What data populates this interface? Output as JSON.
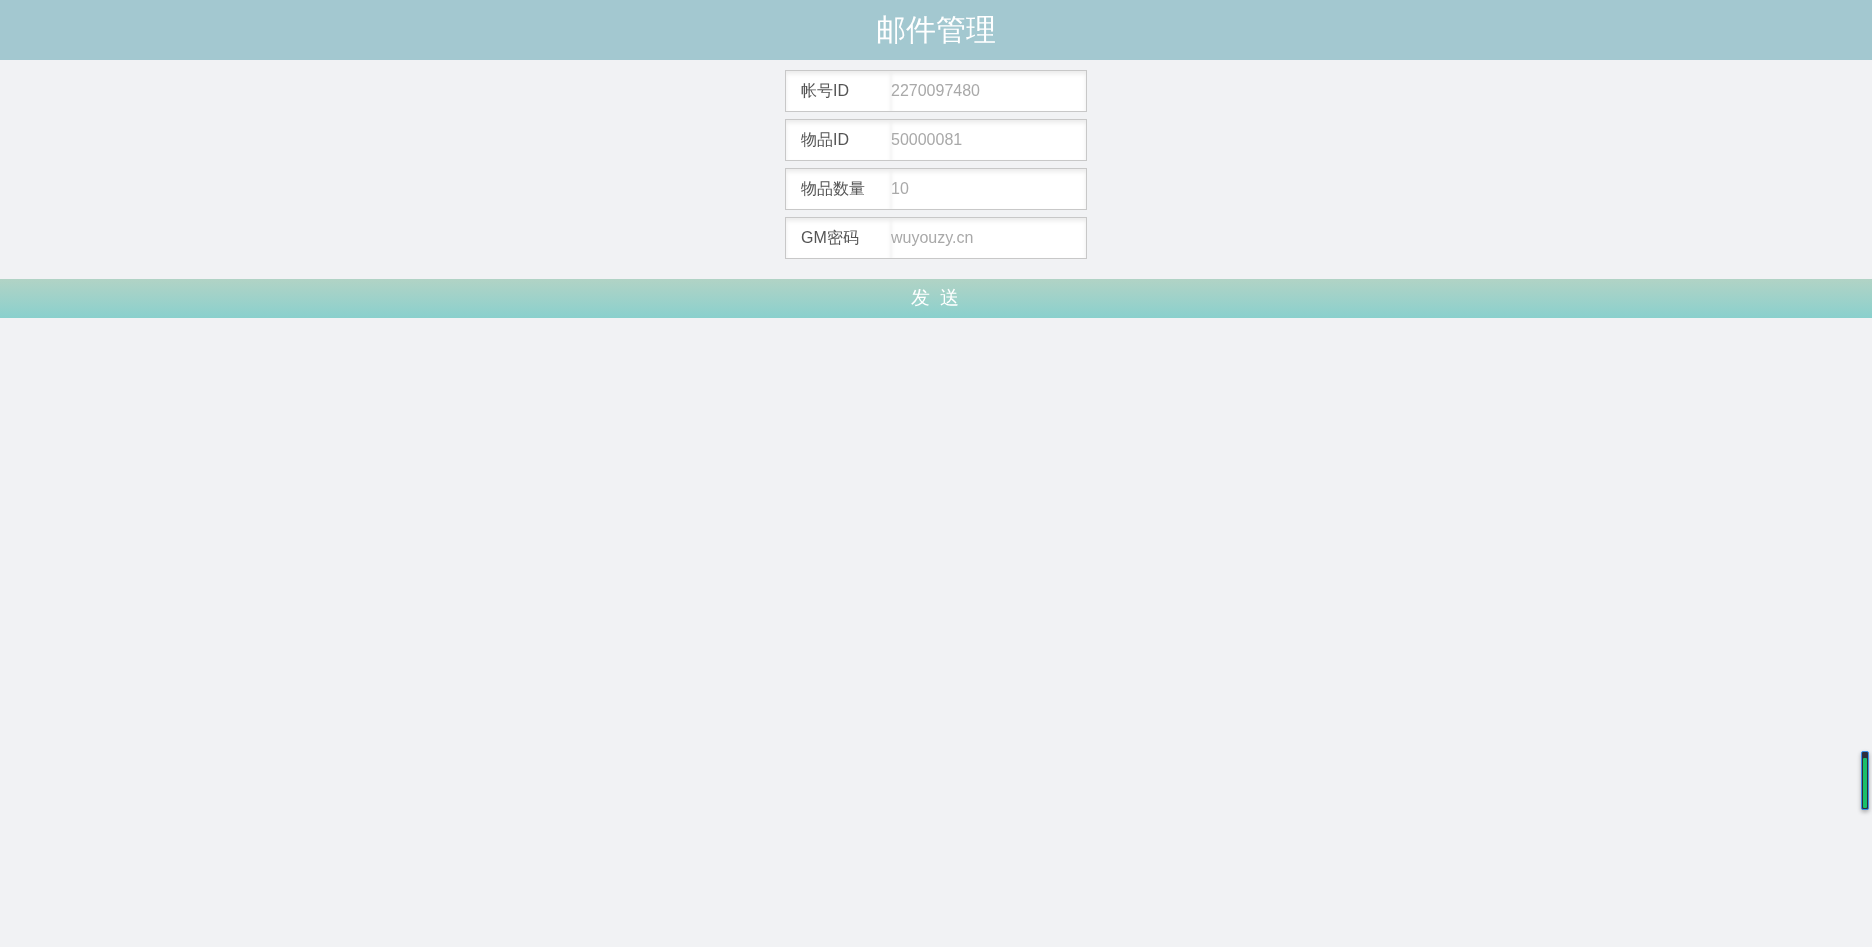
{
  "header": {
    "title": "邮件管理"
  },
  "fields": [
    {
      "label": "帐号ID",
      "placeholder": "2270097480"
    },
    {
      "label": "物品ID",
      "placeholder": "50000081"
    },
    {
      "label": "物品数量",
      "placeholder": "10"
    },
    {
      "label": "GM密码",
      "placeholder": "wuyouzy.cn"
    }
  ],
  "send_button": {
    "label": "发 送"
  }
}
